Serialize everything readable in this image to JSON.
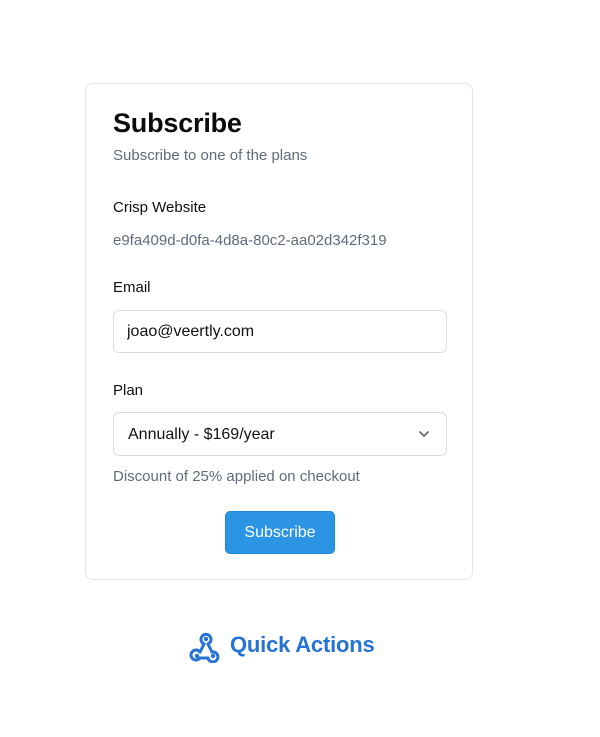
{
  "form": {
    "title": "Subscribe",
    "subtitle": "Subscribe to one of the plans",
    "site_label": "Crisp Website",
    "site_id": "e9fa409d-d0fa-4d8a-80c2-aa02d342f319",
    "email_label": "Email",
    "email_value": "joao@veertly.com",
    "plan_label": "Plan",
    "plan_selected": "Annually - $169/year",
    "discount_note": "Discount of 25% applied on checkout",
    "submit_label": "Subscribe"
  },
  "footer": {
    "brand_name": "Quick Actions",
    "brand_icon": "webhook-icon"
  },
  "colors": {
    "accent": "#2b95e3",
    "brand": "#2573d6",
    "muted_text": "#5f6b7a",
    "border": "#e3e6ea"
  }
}
